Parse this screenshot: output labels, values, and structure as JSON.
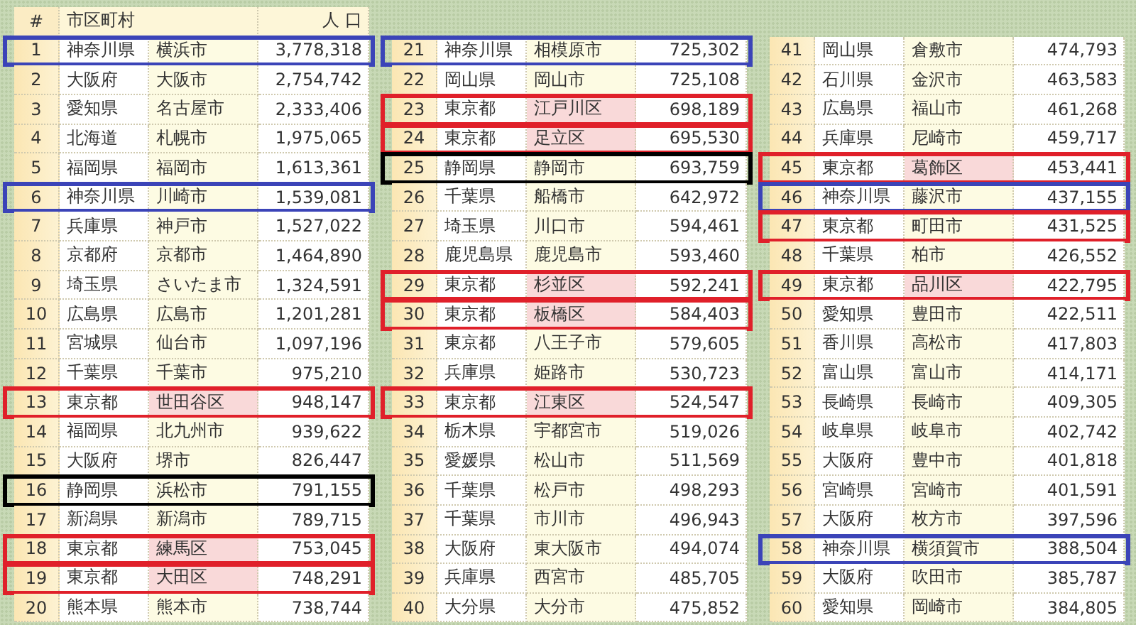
{
  "tables": [
    {
      "header": {
        "rank": "#",
        "place": "市区町村",
        "population": "人 口"
      },
      "rows": [
        {
          "rank": "1",
          "prefecture": "神奈川県",
          "city": "横浜市",
          "population": "3,778,318",
          "color": "#3b44b8",
          "ward": false
        },
        {
          "rank": "2",
          "prefecture": "大阪府",
          "city": "大阪市",
          "population": "2,754,742",
          "ward": false
        },
        {
          "rank": "3",
          "prefecture": "愛知県",
          "city": "名古屋市",
          "population": "2,333,406",
          "ward": false
        },
        {
          "rank": "4",
          "prefecture": "北海道",
          "city": "札幌市",
          "population": "1,975,065",
          "ward": false
        },
        {
          "rank": "5",
          "prefecture": "福岡県",
          "city": "福岡市",
          "population": "1,613,361",
          "ward": false
        },
        {
          "rank": "6",
          "prefecture": "神奈川県",
          "city": "川崎市",
          "population": "1,539,081",
          "color": "#3b44b8",
          "ward": false
        },
        {
          "rank": "7",
          "prefecture": "兵庫県",
          "city": "神戸市",
          "population": "1,527,022",
          "ward": false
        },
        {
          "rank": "8",
          "prefecture": "京都府",
          "city": "京都市",
          "population": "1,464,890",
          "ward": false
        },
        {
          "rank": "9",
          "prefecture": "埼玉県",
          "city": "さいたま市",
          "population": "1,324,591",
          "ward": false
        },
        {
          "rank": "10",
          "prefecture": "広島県",
          "city": "広島市",
          "population": "1,201,281",
          "ward": false
        },
        {
          "rank": "11",
          "prefecture": "宮城県",
          "city": "仙台市",
          "population": "1,097,196",
          "ward": false
        },
        {
          "rank": "12",
          "prefecture": "千葉県",
          "city": "千葉市",
          "population": "975,210",
          "ward": false
        },
        {
          "rank": "13",
          "prefecture": "東京都",
          "city": "世田谷区",
          "population": "948,147",
          "color": "#e0202a",
          "ward": true
        },
        {
          "rank": "14",
          "prefecture": "福岡県",
          "city": "北九州市",
          "population": "939,622",
          "ward": false
        },
        {
          "rank": "15",
          "prefecture": "大阪府",
          "city": "堺市",
          "population": "826,447",
          "ward": false
        },
        {
          "rank": "16",
          "prefecture": "静岡県",
          "city": "浜松市",
          "population": "791,155",
          "color": "#000000",
          "ward": false
        },
        {
          "rank": "17",
          "prefecture": "新潟県",
          "city": "新潟市",
          "population": "789,715",
          "ward": false
        },
        {
          "rank": "18",
          "prefecture": "東京都",
          "city": "練馬区",
          "population": "753,045",
          "color": "#e0202a",
          "ward": true
        },
        {
          "rank": "19",
          "prefecture": "東京都",
          "city": "大田区",
          "population": "748,291",
          "color": "#e0202a",
          "ward": true
        },
        {
          "rank": "20",
          "prefecture": "熊本県",
          "city": "熊本市",
          "population": "738,744",
          "ward": false
        }
      ]
    },
    {
      "rows": [
        {
          "rank": "21",
          "prefecture": "神奈川県",
          "city": "相模原市",
          "population": "725,302",
          "color": "#3b44b8",
          "ward": false
        },
        {
          "rank": "22",
          "prefecture": "岡山県",
          "city": "岡山市",
          "population": "725,108",
          "ward": false
        },
        {
          "rank": "23",
          "prefecture": "東京都",
          "city": "江戸川区",
          "population": "698,189",
          "color": "#e0202a",
          "ward": true
        },
        {
          "rank": "24",
          "prefecture": "東京都",
          "city": "足立区",
          "population": "695,530",
          "color": "#e0202a",
          "ward": true
        },
        {
          "rank": "25",
          "prefecture": "静岡県",
          "city": "静岡市",
          "population": "693,759",
          "color": "#000000",
          "ward": false
        },
        {
          "rank": "26",
          "prefecture": "千葉県",
          "city": "船橋市",
          "population": "642,972",
          "ward": false
        },
        {
          "rank": "27",
          "prefecture": "埼玉県",
          "city": "川口市",
          "population": "594,461",
          "ward": false
        },
        {
          "rank": "28",
          "prefecture": "鹿児島県",
          "city": "鹿児島市",
          "population": "593,460",
          "ward": false
        },
        {
          "rank": "29",
          "prefecture": "東京都",
          "city": "杉並区",
          "population": "592,241",
          "color": "#e0202a",
          "ward": true
        },
        {
          "rank": "30",
          "prefecture": "東京都",
          "city": "板橋区",
          "population": "584,403",
          "color": "#e0202a",
          "ward": true
        },
        {
          "rank": "31",
          "prefecture": "東京都",
          "city": "八王子市",
          "population": "579,605",
          "ward": false
        },
        {
          "rank": "32",
          "prefecture": "兵庫県",
          "city": "姫路市",
          "population": "530,723",
          "ward": false
        },
        {
          "rank": "33",
          "prefecture": "東京都",
          "city": "江東区",
          "population": "524,547",
          "color": "#e0202a",
          "ward": true
        },
        {
          "rank": "34",
          "prefecture": "栃木県",
          "city": "宇都宮市",
          "population": "519,026",
          "ward": false
        },
        {
          "rank": "35",
          "prefecture": "愛媛県",
          "city": "松山市",
          "population": "511,569",
          "ward": false
        },
        {
          "rank": "36",
          "prefecture": "千葉県",
          "city": "松戸市",
          "population": "498,293",
          "ward": false
        },
        {
          "rank": "37",
          "prefecture": "千葉県",
          "city": "市川市",
          "population": "496,943",
          "ward": false
        },
        {
          "rank": "38",
          "prefecture": "大阪府",
          "city": "東大阪市",
          "population": "494,074",
          "ward": false
        },
        {
          "rank": "39",
          "prefecture": "兵庫県",
          "city": "西宮市",
          "population": "485,705",
          "ward": false
        },
        {
          "rank": "40",
          "prefecture": "大分県",
          "city": "大分市",
          "population": "475,852",
          "ward": false
        }
      ]
    },
    {
      "rows": [
        {
          "rank": "41",
          "prefecture": "岡山県",
          "city": "倉敷市",
          "population": "474,793",
          "ward": false
        },
        {
          "rank": "42",
          "prefecture": "石川県",
          "city": "金沢市",
          "population": "463,583",
          "ward": false
        },
        {
          "rank": "43",
          "prefecture": "広島県",
          "city": "福山市",
          "population": "461,268",
          "ward": false
        },
        {
          "rank": "44",
          "prefecture": "兵庫県",
          "city": "尼崎市",
          "population": "459,717",
          "ward": false
        },
        {
          "rank": "45",
          "prefecture": "東京都",
          "city": "葛飾区",
          "population": "453,441",
          "color": "#e0202a",
          "ward": true
        },
        {
          "rank": "46",
          "prefecture": "神奈川県",
          "city": "藤沢市",
          "population": "437,155",
          "color": "#3b44b8",
          "ward": false
        },
        {
          "rank": "47",
          "prefecture": "東京都",
          "city": "町田市",
          "population": "431,525",
          "color": "#e0202a",
          "ward": false
        },
        {
          "rank": "48",
          "prefecture": "千葉県",
          "city": "柏市",
          "population": "426,552",
          "ward": false
        },
        {
          "rank": "49",
          "prefecture": "東京都",
          "city": "品川区",
          "population": "422,795",
          "color": "#e0202a",
          "ward": true
        },
        {
          "rank": "50",
          "prefecture": "愛知県",
          "city": "豊田市",
          "population": "422,511",
          "ward": false
        },
        {
          "rank": "51",
          "prefecture": "香川県",
          "city": "高松市",
          "population": "417,803",
          "ward": false
        },
        {
          "rank": "52",
          "prefecture": "富山県",
          "city": "富山市",
          "population": "414,171",
          "ward": false
        },
        {
          "rank": "53",
          "prefecture": "長崎県",
          "city": "長崎市",
          "population": "409,305",
          "ward": false
        },
        {
          "rank": "54",
          "prefecture": "岐阜県",
          "city": "岐阜市",
          "population": "402,742",
          "ward": false
        },
        {
          "rank": "55",
          "prefecture": "大阪府",
          "city": "豊中市",
          "population": "401,818",
          "ward": false
        },
        {
          "rank": "56",
          "prefecture": "宮崎県",
          "city": "宮崎市",
          "population": "401,591",
          "ward": false
        },
        {
          "rank": "57",
          "prefecture": "大阪府",
          "city": "枚方市",
          "population": "397,596",
          "ward": false
        },
        {
          "rank": "58",
          "prefecture": "神奈川県",
          "city": "横須賀市",
          "population": "388,504",
          "color": "#3b44b8",
          "ward": false
        },
        {
          "rank": "59",
          "prefecture": "大阪府",
          "city": "吹田市",
          "population": "385,787",
          "ward": false
        },
        {
          "rank": "60",
          "prefecture": "愛知県",
          "city": "岡崎市",
          "population": "384,805",
          "ward": false
        }
      ]
    }
  ]
}
